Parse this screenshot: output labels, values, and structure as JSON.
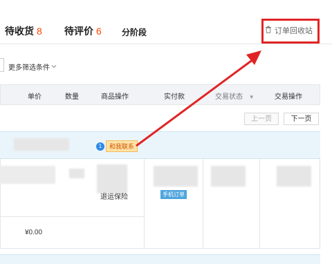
{
  "tabs": {
    "pending_receipt": {
      "label": "待收货",
      "count": "8"
    },
    "pending_review": {
      "label": "待评价",
      "count": "6"
    },
    "installments": {
      "label": "分阶段"
    }
  },
  "recycle_bin": {
    "label": "订单回收站"
  },
  "filter": {
    "more_label": "更多筛选条件"
  },
  "table_headers": {
    "unit_price": "单价",
    "quantity": "数量",
    "item_ops": "商品操作",
    "paid": "实付款",
    "trade_status": "交易状态",
    "trade_ops": "交易操作"
  },
  "pager": {
    "prev": "上一页",
    "next": "下一页"
  },
  "order": {
    "contact_label": "和我联系",
    "shipping_insurance": "退运保险",
    "mobile_order": "手机订单",
    "price": "¥0.00"
  },
  "colors": {
    "accent": "#ff4400",
    "annotation": "#e02424",
    "info": "#4ea4dd"
  }
}
